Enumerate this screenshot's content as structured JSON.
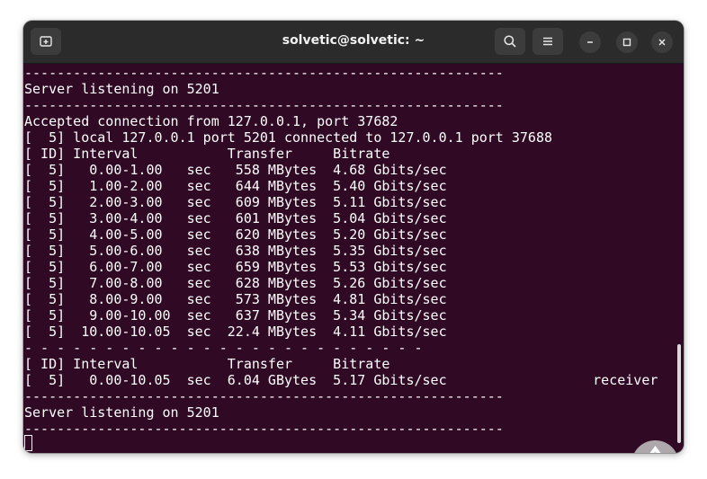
{
  "window": {
    "title": "solvetic@solvetic: ~"
  },
  "titlebar": {
    "new_tab_icon": "new-tab-icon",
    "search_icon": "search-icon",
    "menu_icon": "hamburger-menu-icon",
    "minimize_icon": "minimize-icon",
    "maximize_icon": "maximize-icon",
    "close_icon": "close-icon"
  },
  "terminal": {
    "lines": [
      "-----------------------------------------------------------",
      "Server listening on 5201",
      "-----------------------------------------------------------",
      "Accepted connection from 127.0.0.1, port 37682",
      "[  5] local 127.0.0.1 port 5201 connected to 127.0.0.1 port 37688",
      "[ ID] Interval           Transfer     Bitrate",
      "[  5]   0.00-1.00   sec   558 MBytes  4.68 Gbits/sec",
      "[  5]   1.00-2.00   sec   644 MBytes  5.40 Gbits/sec",
      "[  5]   2.00-3.00   sec   609 MBytes  5.11 Gbits/sec",
      "[  5]   3.00-4.00   sec   601 MBytes  5.04 Gbits/sec",
      "[  5]   4.00-5.00   sec   620 MBytes  5.20 Gbits/sec",
      "[  5]   5.00-6.00   sec   638 MBytes  5.35 Gbits/sec",
      "[  5]   6.00-7.00   sec   659 MBytes  5.53 Gbits/sec",
      "[  5]   7.00-8.00   sec   628 MBytes  5.26 Gbits/sec",
      "[  5]   8.00-9.00   sec   573 MBytes  4.81 Gbits/sec",
      "[  5]   9.00-10.00  sec   637 MBytes  5.34 Gbits/sec",
      "[  5]  10.00-10.05  sec  22.4 MBytes  4.11 Gbits/sec",
      "- - - - - - - - - - - - - - - - - - - - - - - - -",
      "[ ID] Interval           Transfer     Bitrate",
      "[  5]   0.00-10.05  sec  6.04 GBytes  5.17 Gbits/sec                  receiver",
      "-----------------------------------------------------------",
      "Server listening on 5201",
      "-----------------------------------------------------------"
    ]
  },
  "colors": {
    "terminal_bg": "#300a24",
    "titlebar_bg": "#2b2b2b",
    "text": "#ffffff"
  },
  "watermark_icon": "solvetic-logo"
}
